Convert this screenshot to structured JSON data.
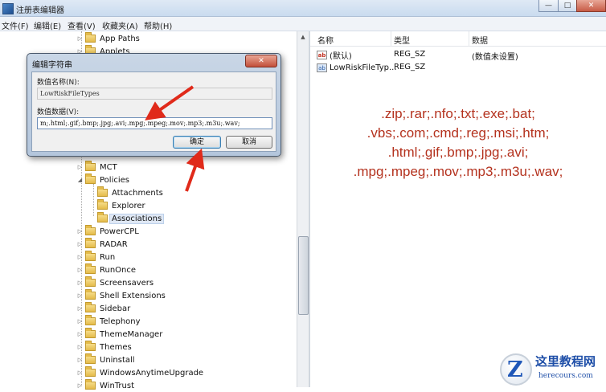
{
  "window": {
    "title": "注册表编辑器",
    "controls": {
      "minimize": "—",
      "maximize": "□",
      "close": "✕"
    }
  },
  "menu": [
    "文件(F)",
    "编辑(E)",
    "查看(V)",
    "收藏夹(A)",
    "帮助(H)"
  ],
  "tree": {
    "items": [
      {
        "label": "App Paths",
        "expander": "▷"
      },
      {
        "label": "Applets",
        "expander": "▷"
      },
      {
        "label": "MCT",
        "expander": "▷"
      },
      {
        "label": "Policies",
        "expander": "◢"
      },
      {
        "label": "Attachments",
        "expander": ""
      },
      {
        "label": "Explorer",
        "expander": ""
      },
      {
        "label": "Associations",
        "expander": "",
        "selected": true
      },
      {
        "label": "PowerCPL",
        "expander": "▷"
      },
      {
        "label": "RADAR",
        "expander": "▷"
      },
      {
        "label": "Run",
        "expander": "▷"
      },
      {
        "label": "RunOnce",
        "expander": "▷"
      },
      {
        "label": "Screensavers",
        "expander": "▷"
      },
      {
        "label": "Shell Extensions",
        "expander": "▷"
      },
      {
        "label": "Sidebar",
        "expander": "▷"
      },
      {
        "label": "Telephony",
        "expander": "▷"
      },
      {
        "label": "ThemeManager",
        "expander": "▷"
      },
      {
        "label": "Themes",
        "expander": "▷"
      },
      {
        "label": "Uninstall",
        "expander": "▷"
      },
      {
        "label": "WindowsAnytimeUpgrade",
        "expander": "▷"
      },
      {
        "label": "WinTrust",
        "expander": "▷"
      }
    ]
  },
  "list": {
    "headers": {
      "name": "名称",
      "type": "类型",
      "data": "数据"
    },
    "rows": [
      {
        "icon": "ab",
        "name": "(默认)",
        "type": "REG_SZ",
        "data": "(数值未设置)"
      },
      {
        "icon": "bin",
        "name": "LowRiskFileTyp...",
        "type": "REG_SZ",
        "data": ""
      }
    ]
  },
  "annotation": {
    "lines": [
      ".zip;.rar;.nfo;.txt;.exe;.bat;",
      ".vbs;.com;.cmd;.reg;.msi;.htm;",
      ".html;.gif;.bmp;.jpg;.avi;",
      ".mpg;.mpeg;.mov;.mp3;.m3u;.wav;"
    ],
    "color": "#b4321e"
  },
  "dialog": {
    "title": "编辑字符串",
    "close": "✕",
    "name_label": "数值名称(N):",
    "name_value": "LowRiskFileTypes",
    "data_label": "数值数据(V):",
    "data_value": "m;.html;.gif;.bmp;.jpg;.avi;.mpg;.mpeg;.mov;.mp3;.m3u;.wav;",
    "ok": "确定",
    "cancel": "取消"
  },
  "watermark": {
    "cn": "这里教程网",
    "en": "herecours.com",
    "glyph": "Z"
  },
  "colors": {
    "arrow": "#e02a1a",
    "selection": "#dfe8f5"
  }
}
